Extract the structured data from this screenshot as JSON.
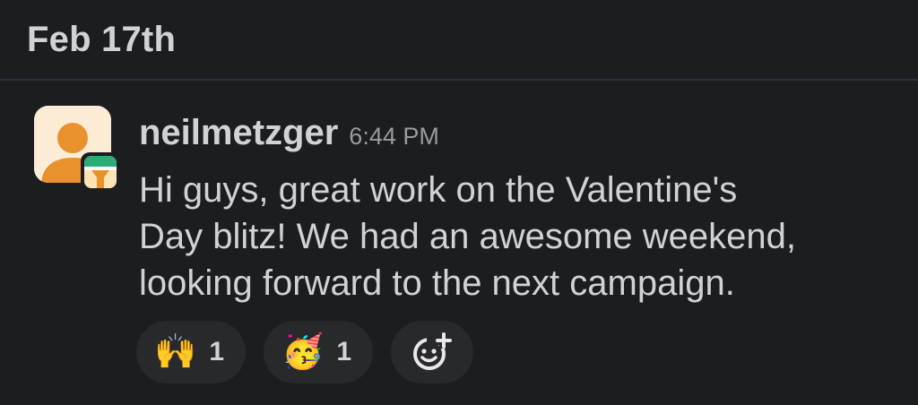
{
  "date_header": "Feb 17th",
  "message": {
    "username": "neilmetzger",
    "timestamp": "6:44 PM",
    "text_lines": [
      "Hi guys, great work on the Valentine's",
      "Day blitz! We had an awesome weekend,",
      "looking forward to the next campaign."
    ],
    "avatar_icon": "default-user-avatar-icon",
    "app_badge_icon": "app-badge-icon"
  },
  "reactions": [
    {
      "emoji": "🙌",
      "icon": "raising-hands-emoji",
      "count": "1"
    },
    {
      "emoji": "🥳",
      "icon": "partying-face-emoji",
      "count": "1"
    }
  ],
  "add_reaction_icon": "add-reaction-icon",
  "colors": {
    "background": "#1b1d21",
    "text": "#d1d2d3",
    "timestamp": "#9a9b9e",
    "reaction_pill": "#27292d",
    "avatar_bg": "#fbecd6",
    "avatar_figure": "#e8912d"
  }
}
